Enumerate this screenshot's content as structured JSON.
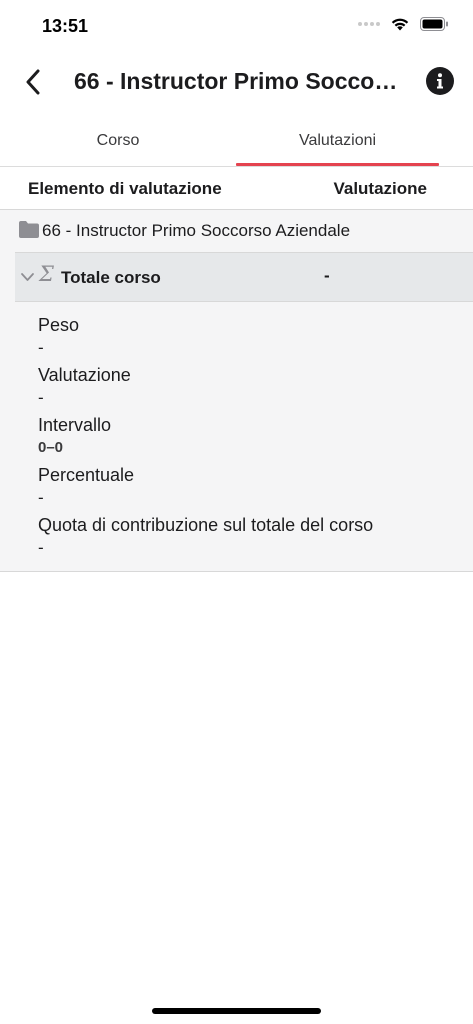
{
  "status_bar": {
    "time": "13:51"
  },
  "nav": {
    "title": "66 - Instructor Primo Soccorso Aziendale",
    "back_icon": "chevron-left-icon",
    "info_icon": "info-icon"
  },
  "tabs": [
    {
      "label": "Corso",
      "active": false
    },
    {
      "label": "Valutazioni",
      "active": true
    }
  ],
  "colors": {
    "accent": "#e4434f",
    "row_highlight": "#e6e8ea",
    "panel_bg": "#f5f5f6"
  },
  "table": {
    "header": {
      "element": "Elemento di valutazione",
      "grade": "Valutazione"
    },
    "course": {
      "icon": "folder-icon",
      "name": "66 - Instructor Primo Soccorso Aziendale"
    },
    "total": {
      "icon": "sigma-icon",
      "label": "Totale corso",
      "value": "-",
      "expanded": true
    },
    "details": [
      {
        "label": "Peso",
        "value": "-"
      },
      {
        "label": "Valutazione",
        "value": "-"
      },
      {
        "label": "Intervallo",
        "value": "0–0"
      },
      {
        "label": "Percentuale",
        "value": "-"
      },
      {
        "label": "Quota di contribuzione sul totale del corso",
        "value": "-"
      }
    ]
  }
}
